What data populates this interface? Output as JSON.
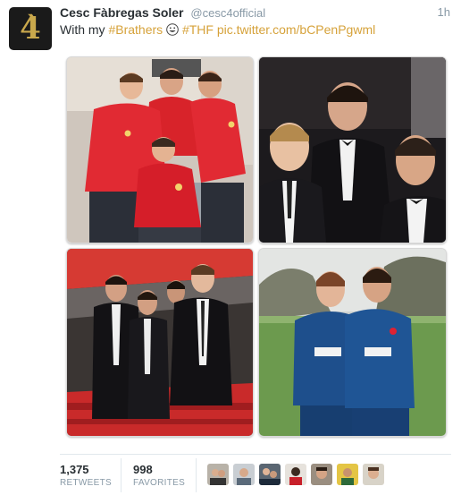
{
  "tweet": {
    "fullname": "Cesc Fàbregas Soler",
    "handle": "@cesc4official",
    "time": "1h",
    "text_prefix": "With my ",
    "hashtag_1": "#Brathers",
    "hashtag_2": "#THF",
    "link": "pic.twitter.com/bCPenPgwml",
    "avatar_glyph": "4̀",
    "accent_color": "#d6a23a"
  },
  "stats": {
    "retweets_count": "1,375",
    "retweets_label": "RETWEETS",
    "favorites_count": "998",
    "favorites_label": "FAVORITES"
  },
  "favoriters": [
    {
      "name": "favoriter-avatar-1"
    },
    {
      "name": "favoriter-avatar-2"
    },
    {
      "name": "favoriter-avatar-3"
    },
    {
      "name": "favoriter-avatar-4"
    },
    {
      "name": "favoriter-avatar-5"
    },
    {
      "name": "favoriter-avatar-6"
    },
    {
      "name": "favoriter-avatar-7"
    }
  ],
  "photos": [
    {
      "scene": "four-friends-in-red-training-tops"
    },
    {
      "scene": "three-men-in-black-tuxedos-at-night"
    },
    {
      "scene": "four-men-in-suits-in-stadium-stand"
    },
    {
      "scene": "two-players-in-blue-training-kit-on-pitch"
    }
  ]
}
